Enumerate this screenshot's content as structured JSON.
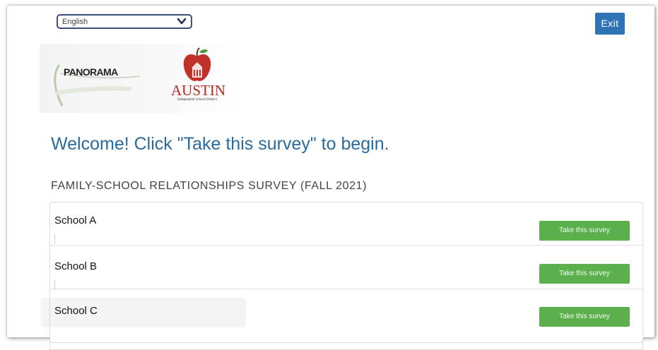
{
  "language_select": {
    "selected": "English"
  },
  "exit_label": "Exit",
  "logos": {
    "panorama": "PANORAMA",
    "austin": "AUSTIN",
    "austin_sub": "Independent School District"
  },
  "welcome": "Welcome! Click \"Take this survey\" to begin.",
  "survey_title": "FAMILY-SCHOOL RELATIONSHIPS SURVEY (FALL 2021)",
  "schools": [
    {
      "name": "School A",
      "button": "Take this survey"
    },
    {
      "name": "School B",
      "button": "Take this survey"
    },
    {
      "name": "School C",
      "button": "Take this survey"
    }
  ],
  "colors": {
    "accent_blue": "#2e74b5",
    "heading_blue": "#2b6a9c",
    "button_green": "#5bb04d",
    "austin_red": "#b22a22"
  }
}
